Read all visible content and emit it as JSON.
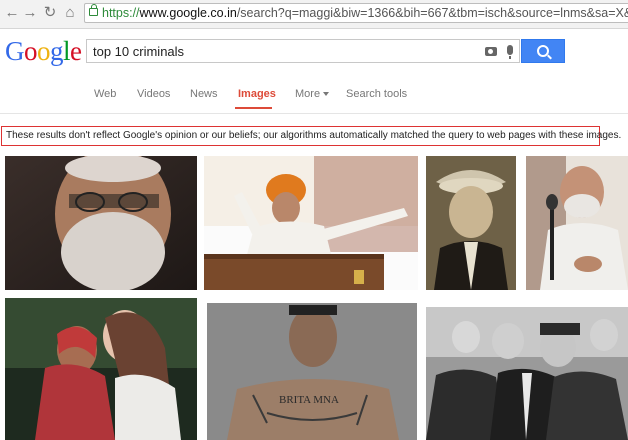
{
  "browser": {
    "url_scheme": "https://",
    "url_host": "www.google.co.in",
    "url_path": "/search?q=maggi&biw=1366&bih=667&tbm=isch&source=lnms&sa=X&ei"
  },
  "header": {
    "logo_letters": [
      "G",
      "o",
      "o",
      "g",
      "l",
      "e"
    ],
    "search_value": "top 10 criminals"
  },
  "tabs": [
    {
      "label": "Web",
      "active": false
    },
    {
      "label": "Videos",
      "active": false
    },
    {
      "label": "News",
      "active": false
    },
    {
      "label": "Images",
      "active": true
    },
    {
      "label": "More",
      "active": false
    },
    {
      "label": "Search tools",
      "active": false
    }
  ],
  "notice": {
    "text": "These results don't reflect Google's opinion or our beliefs; our algorithms automatically matched the query to web pages with these images."
  },
  "images": [
    {
      "alt": "",
      "accent": "#6f5343"
    },
    {
      "alt": "",
      "accent": "#e07a1e"
    },
    {
      "alt": "",
      "accent": "#3a3428"
    },
    {
      "alt": "",
      "accent": "#8c6b58"
    },
    {
      "alt": "",
      "accent": "#b0353a"
    },
    {
      "alt": "",
      "accent": "#7a6658"
    },
    {
      "alt": "",
      "accent": "#4c4c4c"
    }
  ],
  "colors": {
    "accent_red": "#dd4b39",
    "search_blue": "#4285f4"
  }
}
